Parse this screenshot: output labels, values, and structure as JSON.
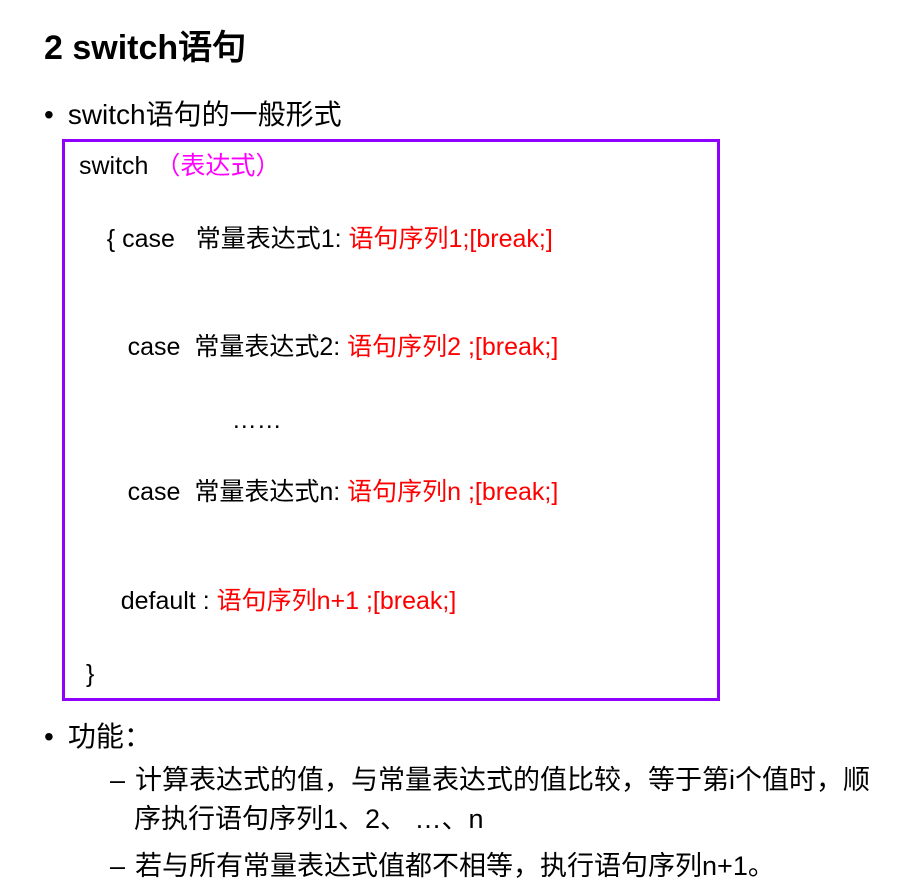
{
  "title": "2  switch语句",
  "section1": {
    "label": "switch语句的一般形式"
  },
  "code": {
    "l1_a": "switch ",
    "l1_b": "（",
    "l1_c": "表达式",
    "l1_d": "）",
    "l2_a": "{ case   常量表达式1: ",
    "l2_b": "语句序列1;[break;]",
    "l3_a": "   case  常量表达式2: ",
    "l3_b": "语句序列2 ;[break;]",
    "l4": "                      ……",
    "l5_a": "   case  常量表达式n: ",
    "l5_b": "语句序列n ;[break;]",
    "l6_a": "  default : ",
    "l6_b": "语句序列n+1 ;[break;]",
    "l7": " }"
  },
  "section2": {
    "label": "功能：",
    "sub1": "计算表达式的值，与常量表达式的值比较，等于第i个值时，顺序执行语句序列1、2、 …、n",
    "sub2": "若与所有常量表达式值都不相等，执行语句序列n+1。"
  }
}
